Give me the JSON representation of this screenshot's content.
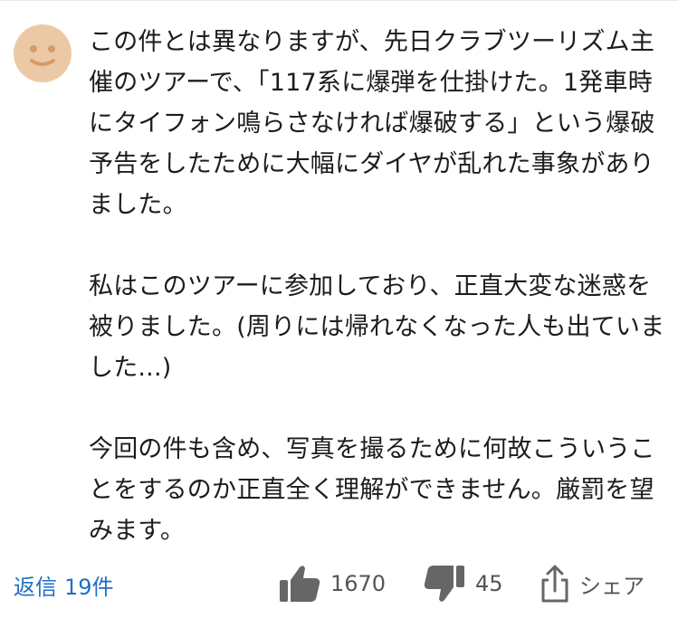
{
  "comment": {
    "avatar_icon": "smiley-face-icon",
    "avatar_color": "#ecc9a6",
    "paragraphs": [
      "この件とは異なりますが、先日クラブツーリズム主催のツアーで、「117系に爆弾を仕掛けた。1発車時にタイフォン鳴らさなければ爆破する」という爆破予告をしたために大幅にダイヤが乱れた事象がありました。",
      "私はこのツアーに参加しており、正直大変な迷惑を被りました。(周りには帰れなくなった人も出ていました...)",
      "今回の件も含め、写真を撮るために何故こういうことをするのか正直全く理解ができません。厳罰を望みます。"
    ]
  },
  "footer": {
    "reply_label": "返信",
    "reply_count": "19件",
    "like_icon": "thumbs-up-icon",
    "like_count": "1670",
    "dislike_icon": "thumbs-down-icon",
    "dislike_count": "45",
    "share_icon": "share-icon",
    "share_label": "シェア"
  },
  "colors": {
    "link": "#1f6fc4",
    "text": "#1c1c1c",
    "muted": "#555555"
  }
}
